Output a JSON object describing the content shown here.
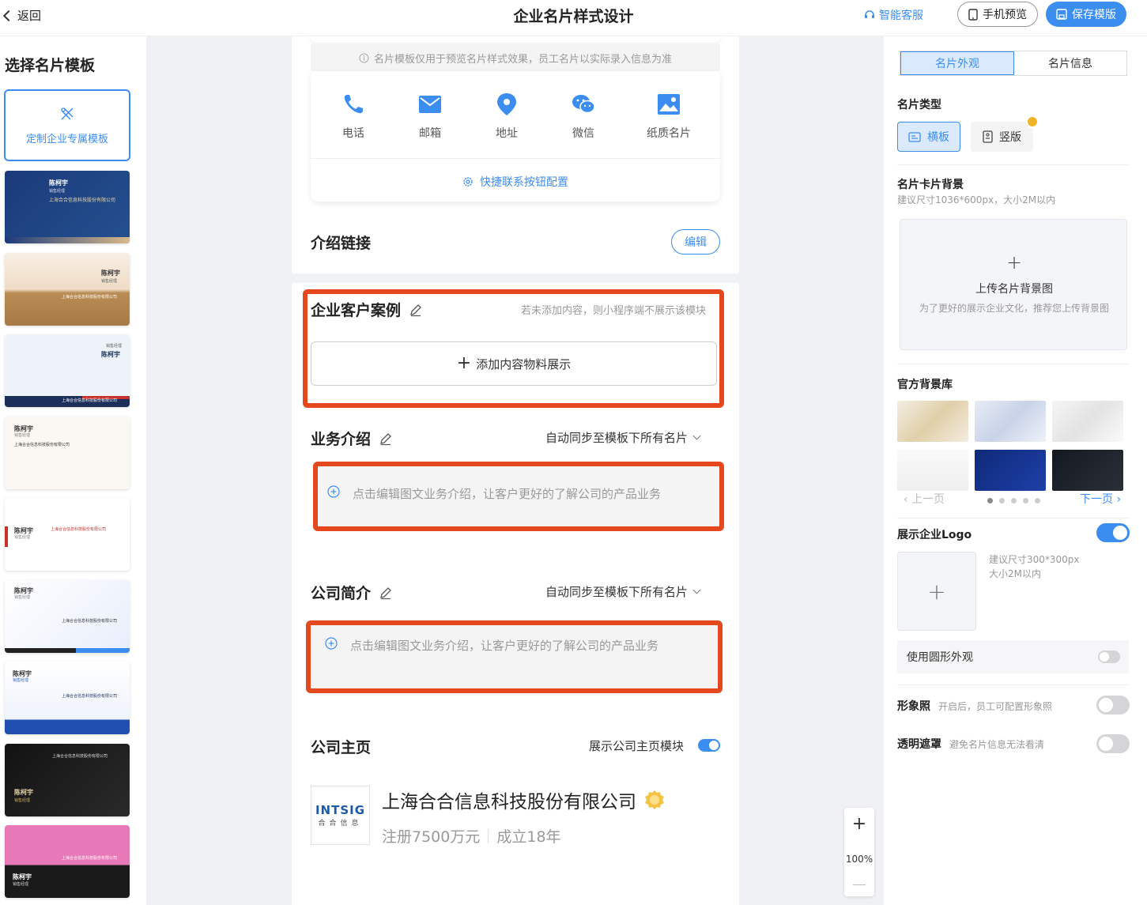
{
  "header": {
    "back_label": "返回",
    "title": "企业名片样式设计",
    "service_label": "智能客服",
    "preview_label": "手机预览",
    "save_label": "保存模版"
  },
  "left": {
    "title": "选择名片模板",
    "custom_label": "定制企业专属模板",
    "templates": [
      {
        "name": "陈柯宇",
        "role": "销售经理",
        "company": "上海合合信息科技股份有限公司"
      },
      {
        "name": "陈柯宇",
        "role": "销售经理",
        "company": "上海合合信息科技股份有限公司"
      },
      {
        "name": "陈柯宇",
        "role": "销售经理",
        "company": "上海合合信息科技股份有限公司"
      },
      {
        "name": "陈柯宇",
        "role": "销售经理",
        "company": "上海合合信息科技股份有限公司"
      },
      {
        "name": "陈柯宇",
        "role": "销售经理",
        "company": "上海合合信息科技股份有限公司"
      },
      {
        "name": "陈柯宇",
        "role": "销售经理",
        "company": "上海合合信息科技股份有限公司"
      },
      {
        "name": "陈柯宇",
        "role": "销售经理",
        "company": "上海合合信息科技股份有限公司"
      },
      {
        "name": "陈柯宇",
        "role": "销售经理",
        "company": "上海合合信息科技股份有限公司"
      },
      {
        "name": "陈柯宇",
        "role": "销售经理",
        "company": "上海合合信息科技股份有限公司"
      }
    ]
  },
  "canvas": {
    "notice": "名片模板仅用于预览名片样式效果，员工名片以实际录入信息为准",
    "contacts": [
      {
        "label": "电话",
        "icon": "phone-icon"
      },
      {
        "label": "邮箱",
        "icon": "mail-icon"
      },
      {
        "label": "地址",
        "icon": "location-icon"
      },
      {
        "label": "微信",
        "icon": "wechat-icon"
      },
      {
        "label": "纸质名片",
        "icon": "image-icon"
      }
    ],
    "contact_config_label": "快捷联系按钮配置",
    "intro_link_title": "介绍链接",
    "edit_label": "编辑",
    "cases_title": "企业客户案例",
    "cases_hint": "若未添加内容，则小程序端不展示该模块",
    "add_content_label": "添加内容物料展示",
    "business_title": "业务介绍",
    "sync_label": "自动同步至模板下所有名片",
    "business_placeholder": "点击编辑图文业务介绍，让客户更好的了解公司的产品业务",
    "profile_title": "公司简介",
    "profile_sync_label": "自动同步至模板下所有名片",
    "profile_placeholder": "点击编辑图文业务介绍，让客户更好的了解公司的产品业务",
    "homepage_title": "公司主页",
    "homepage_toggle_label": "展示公司主页模块",
    "company_logo_text": "INTSIG",
    "company_logo_sub": "合合信息",
    "company_name": "上海合合信息科技股份有限公司",
    "company_capital": "注册7500万元",
    "company_age": "成立18年",
    "zoom": "100%"
  },
  "right": {
    "tab_appearance": "名片外观",
    "tab_info": "名片信息",
    "type_label": "名片类型",
    "type_horizontal": "横板",
    "type_vertical": "竖版",
    "bg_label": "名片卡片背景",
    "bg_hint": "建议尺寸1036*600px，大小2M以内",
    "upload_title": "上传名片背景图",
    "upload_desc": "为了更好的展示企业文化，推荐您上传背景图",
    "library_label": "官方背景库",
    "prev_page": "上一页",
    "next_page": "下一页",
    "logo_label": "展示企业Logo",
    "logo_hint_1": "建议尺寸300*300px",
    "logo_hint_2": "大小2M以内",
    "round_label": "使用圆形外观",
    "portrait_label": "形象照",
    "portrait_hint": "开启后，员工可配置形象照",
    "mask_label": "透明遮罩",
    "mask_hint": "避免名片信息无法看清"
  },
  "colors": {
    "accent": "#3b8ef0",
    "highlight_border": "#e5481c"
  }
}
